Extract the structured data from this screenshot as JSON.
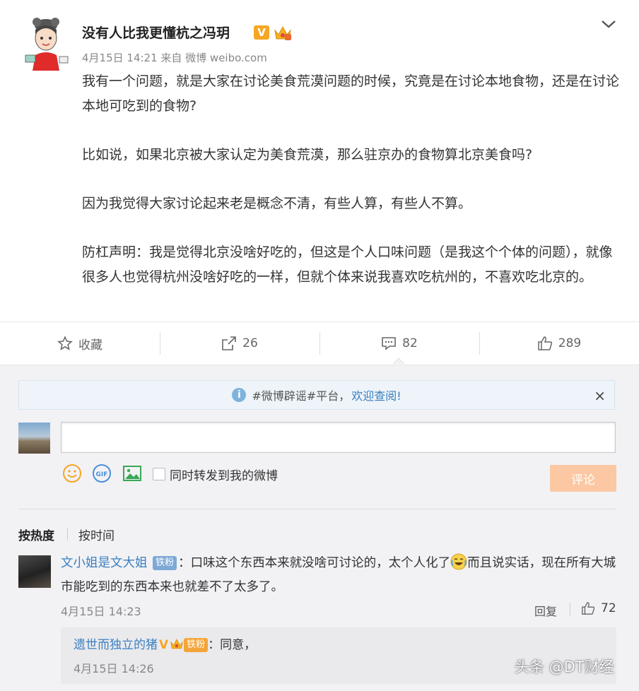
{
  "post": {
    "author": "没有人比我更懂杭之冯玥",
    "verified_badge": "V",
    "meta": "4月15日 14:21 来自 微博 weibo.com",
    "paragraphs": [
      "我有一个问题，就是大家在讨论美食荒漠问题的时候，究竟是在讨论本地食物，还是在讨论本地可吃到的食物?",
      "比如说，如果北京被大家认定为美食荒漠，那么驻京办的食物算北京美食吗?",
      "因为我觉得大家讨论起来老是概念不清，有些人算，有些人不算。",
      "防杠声明：我是觉得北京没啥好吃的，但这是个人口味问题（是我这个个体的问题），就像很多人也觉得杭州没啥好吃的一样，但就个体来说我喜欢吃杭州的，不喜欢吃北京的。"
    ]
  },
  "actions": {
    "favorite_label": "收藏",
    "repost_count": "26",
    "comment_count": "82",
    "like_count": "289"
  },
  "notice": {
    "text": "#微博辟谣#平台，",
    "link": "欢迎查阅!",
    "close": "×"
  },
  "composer": {
    "placeholder": "",
    "repost_checkbox_label": "同时转发到我的微博",
    "submit_label": "评论"
  },
  "sort": {
    "hot": "按热度",
    "time": "按时间"
  },
  "comments": [
    {
      "user": "文小姐是文大姐",
      "fan_badge": "铁粉",
      "text_before": "：口味这个东西本来就没啥可讨论的，太个人化了",
      "text_after": "而且说实话，现在所有大城市能吃到的东西本来也就差不了太多了。",
      "time": "4月15日 14:23",
      "reply_label": "回复",
      "likes": "72",
      "reply": {
        "user": "遗世而独立的猪",
        "badge_v": "V",
        "fan_badge": "铁粉",
        "text": "：同意，",
        "time": "4月15日 14:26"
      }
    }
  ],
  "watermark": "头条 @DT财经",
  "colors": {
    "link_blue": "#3b7fc0",
    "submit_disabled": "#fbc8a3",
    "verified_orange": "#f5a623"
  }
}
